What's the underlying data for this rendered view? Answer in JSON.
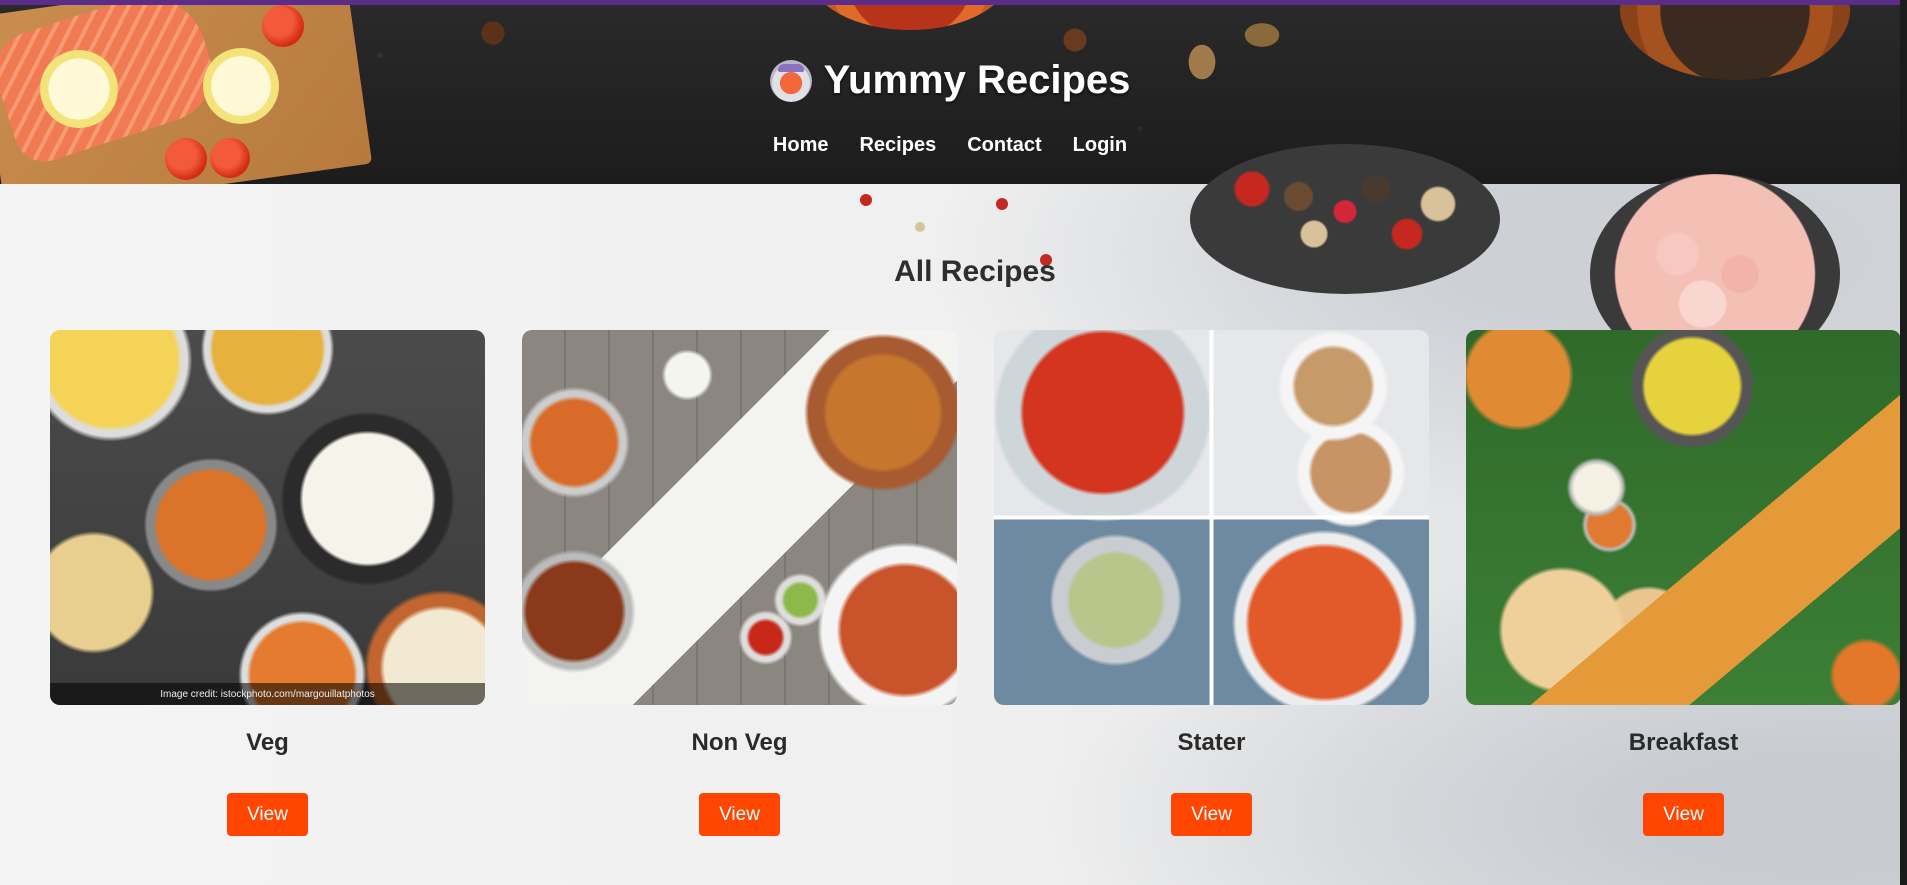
{
  "site": {
    "title": "Yummy Recipes",
    "logo_icon": "cooking-pot-icon"
  },
  "nav": {
    "items": [
      {
        "label": "Home"
      },
      {
        "label": "Recipes"
      },
      {
        "label": "Contact"
      },
      {
        "label": "Login"
      }
    ]
  },
  "main": {
    "heading": "All Recipes",
    "cards": [
      {
        "title": "Veg",
        "button": "View",
        "image_credit": "Image credit: istockphoto.com/margouillatphotos"
      },
      {
        "title": "Non Veg",
        "button": "View"
      },
      {
        "title": "Stater",
        "button": "View"
      },
      {
        "title": "Breakfast",
        "button": "View"
      }
    ]
  },
  "colors": {
    "accent_button": "#ff4500",
    "header_bg": "#1f1f1f",
    "top_border": "#5b2c8a"
  }
}
